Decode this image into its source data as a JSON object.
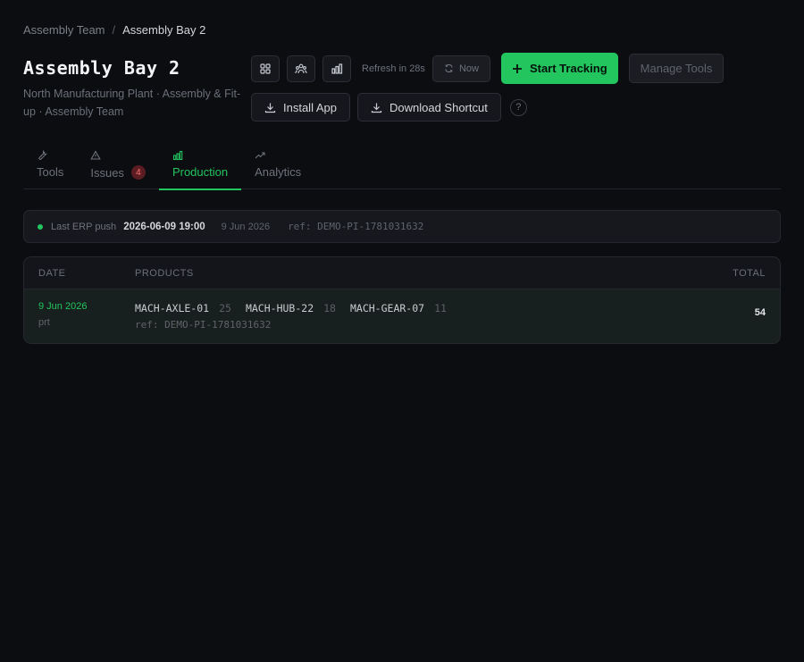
{
  "breadcrumb": {
    "parent": "Assembly Team",
    "separator": "/",
    "current": "Assembly Bay 2"
  },
  "header": {
    "title": "Assembly Bay 2",
    "subtitle": "North Manufacturing Plant · Assembly & Fit-up · Assembly Team"
  },
  "toolbar": {
    "view_icons": [
      "grid-icon",
      "team-icon",
      "bar-chart-icon"
    ],
    "refresh_text": "Refresh in 28s",
    "now_label": "Now",
    "start_label": "Start Tracking",
    "manage_label": "Manage Tools",
    "install_label": "Install App",
    "download_label": "Download Shortcut",
    "help_label": "?"
  },
  "tabs": [
    {
      "label": "Tools",
      "icon": "wrench-icon",
      "badge": ""
    },
    {
      "label": "Issues",
      "icon": "warning-icon",
      "badge": "4"
    },
    {
      "label": "Production",
      "icon": "bar-chart-icon",
      "badge": "",
      "active": true
    },
    {
      "label": "Analytics",
      "icon": "trend-icon",
      "badge": ""
    }
  ],
  "erp": {
    "label": "Last ERP push",
    "timestamp": "2026-06-09 19:00",
    "date": "9 Jun 2026",
    "ref": "ref: DEMO-PI-1781031632"
  },
  "table": {
    "headers": {
      "date": "DATE",
      "products": "PRODUCTS",
      "total": "TOTAL"
    },
    "rows": [
      {
        "date": "9 Jun 2026",
        "shift": "prt",
        "products": [
          {
            "code": "MACH-AXLE-01",
            "qty": "25"
          },
          {
            "code": "MACH-HUB-22",
            "qty": "18"
          },
          {
            "code": "MACH-GEAR-07",
            "qty": "11"
          }
        ],
        "ref": "ref: DEMO-PI-1781031632",
        "total": "54"
      }
    ]
  },
  "colors": {
    "accent": "#22c55e",
    "background": "#0c0d11",
    "badge_bg": "#5b1d22",
    "badge_text": "#f87171"
  }
}
